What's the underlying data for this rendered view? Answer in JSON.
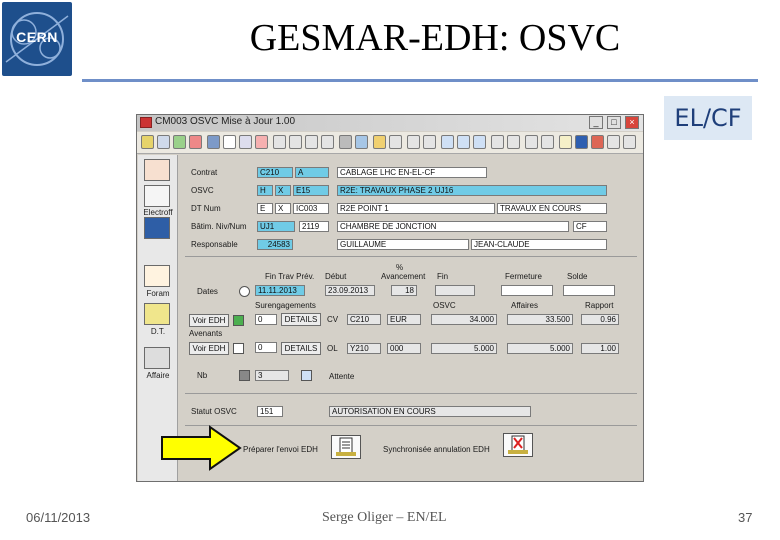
{
  "slide": {
    "logo_text": "CERN",
    "title": "GESMAR-EDH: OSVC",
    "badge": "EL/CF",
    "footer_date": "06/11/2013",
    "footer_author": "Serge Oliger – EN/EL",
    "footer_page": "37"
  },
  "window": {
    "title": "CM003 OSVC Mise à Jour 1.00",
    "controls": [
      "_",
      "□",
      "×"
    ]
  },
  "leftbar": {
    "labels": [
      "Electroff",
      "Foram",
      "D.T.",
      "Affaire"
    ]
  },
  "form": {
    "labels": {
      "control": "Contrat",
      "osvc": "OSVC",
      "dt_num": "DT Num",
      "batim": "Bâtim. Niv/Num",
      "responsable": "Responsable",
      "dates": "Dates",
      "fin_prev": "Fin Trav Prév.",
      "debut": "Début",
      "pct": "%",
      "avancement": "Avancement",
      "fin": "Fin",
      "fermeture": "Fermeture",
      "solde": "Solde",
      "sur_engagements": "Surengagements",
      "osvc_col": "OSVC",
      "affaire_col": "Affaires",
      "rapport_col": "Rapport",
      "avenants": "Avenants",
      "nb": "Nb",
      "attente": "Attente",
      "statut": "Statut OSVC",
      "preparer": "Préparer l'envoi EDH",
      "synchro": "Synchronisée annulation EDH"
    },
    "fields": {
      "control_code": "C210",
      "control_flag": "A",
      "control_desc": "CABLAGE LHC EN-EL-CF",
      "osvc_a": "H",
      "osvc_b": "X",
      "osvc_c": "E15",
      "osvc_desc": "R2E: TRAVAUX PHASE 2 UJ16",
      "dt_a": "E",
      "dt_b": "X",
      "dt_c": "IC003",
      "dt_desc": "R2E POINT 1",
      "dt_status": "TRAVAUX EN COURS",
      "batim_a": "UJ1",
      "batim_b": "2119",
      "batim_desc": "CHAMBRE DE JONCTION",
      "batim_code": "CF",
      "resp_id": "24583",
      "resp_last": "GUILLAUME",
      "resp_first": "JEAN-CLAUDE",
      "fin_prev_val": "11.11.2013",
      "debut_val": "23.09.2013",
      "avancement_val": "18",
      "engagement_count": "0",
      "cv_label": "CV",
      "cv_code": "C210",
      "cv_cur": "EUR",
      "cv_osvc": "34.000",
      "cv_affaire": "33.500",
      "cv_rapport": "0.96",
      "avenant_count": "0",
      "ol_label": "OL",
      "ol_code": "Y210",
      "ol_cur": "000",
      "ol_osvc": "5.000",
      "ol_affaire": "5.000",
      "ol_rapport": "1.00",
      "nb_val": "3",
      "statut_code": "151",
      "statut_desc": "AUTORISATION EN COURS"
    },
    "buttons": {
      "voir_edh_1": "Voir EDH",
      "detail_1": "DETAILS",
      "voir_edh_2": "Voir EDH",
      "detail_2": "DETAILS"
    }
  }
}
